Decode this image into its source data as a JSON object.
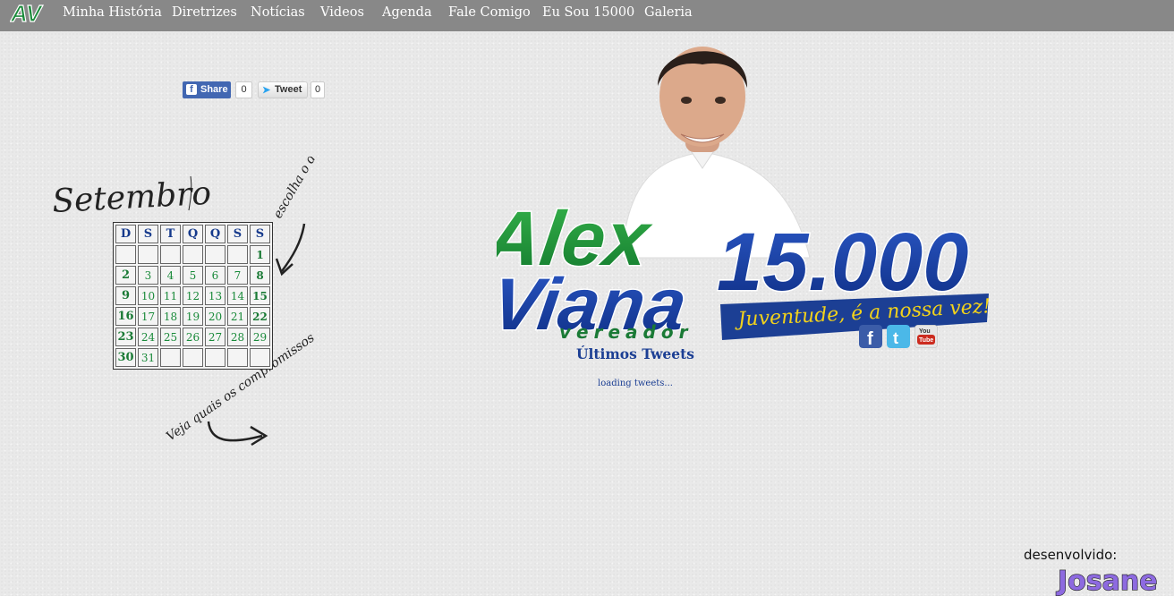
{
  "logo": {
    "text": "AV"
  },
  "nav": [
    {
      "label": "Minha História",
      "name": "nav-minha-historia"
    },
    {
      "label": "Diretrizes",
      "name": "nav-diretrizes"
    },
    {
      "label": "Notícias",
      "name": "nav-noticias"
    },
    {
      "label": "Videos",
      "name": "nav-videos"
    },
    {
      "label": "Agenda",
      "name": "nav-agenda"
    },
    {
      "label": "Fale Comigo",
      "name": "nav-fale-comigo"
    },
    {
      "label": "Eu Sou 15000",
      "name": "nav-eu-sou-15000"
    },
    {
      "label": "Galeria",
      "name": "nav-galeria"
    }
  ],
  "share": {
    "fb_label": "Share",
    "fb_count": "0",
    "tw_label": "Tweet",
    "tw_count": "0"
  },
  "calendar": {
    "month_script": "Setembro",
    "note_top": "escolha o dia",
    "note_bottom": "Veja quais os compromissos",
    "headers": [
      "D",
      "S",
      "T",
      "Q",
      "Q",
      "S",
      "S"
    ],
    "weeks": [
      [
        "",
        "",
        "",
        "",
        "",
        "",
        "1"
      ],
      [
        "2",
        "3",
        "4",
        "5",
        "6",
        "7",
        "8"
      ],
      [
        "9",
        "10",
        "11",
        "12",
        "13",
        "14",
        "15"
      ],
      [
        "16",
        "17",
        "18",
        "19",
        "20",
        "21",
        "22"
      ],
      [
        "23",
        "24",
        "25",
        "26",
        "27",
        "28",
        "29"
      ],
      [
        "30",
        "31",
        "",
        "",
        "",
        "",
        ""
      ]
    ]
  },
  "hero": {
    "name_line1": "Alex",
    "name_line2": "Viana",
    "role": "vereador",
    "number": "15.000",
    "slogan": "Juventude, é a nossa vez!"
  },
  "tweets": {
    "title": "Últimos Tweets",
    "loading": "loading tweets..."
  },
  "social_icons": [
    "facebook-icon",
    "twitter-icon",
    "youtube-icon"
  ],
  "footer": {
    "credit_label": "desenvolvido:",
    "credit_brand": "Josane"
  },
  "colors": {
    "topbar": "#888888",
    "brand_blue": "#1c3f94",
    "brand_green": "#1a8a3a",
    "slogan_yellow": "#f2d21b"
  }
}
